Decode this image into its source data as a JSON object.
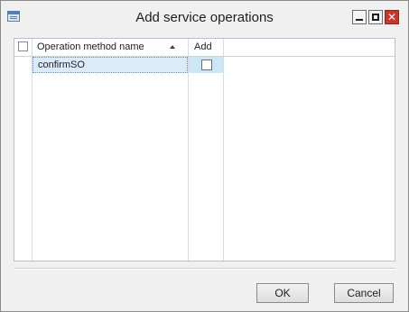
{
  "window": {
    "title": "Add service operations",
    "controls": {
      "minimize": "minimize",
      "maximize": "maximize",
      "close": "✕"
    }
  },
  "grid": {
    "columns": [
      {
        "label": "Operation method name",
        "sort": "ascending"
      },
      {
        "label": "Add"
      }
    ],
    "rows": [
      {
        "operation_method_name": "confirmSO",
        "add": false,
        "selected": true
      }
    ]
  },
  "footer": {
    "ok_label": "OK",
    "cancel_label": "Cancel"
  },
  "colors": {
    "selected_row": "#dcebfa",
    "close_button": "#c7372f"
  }
}
